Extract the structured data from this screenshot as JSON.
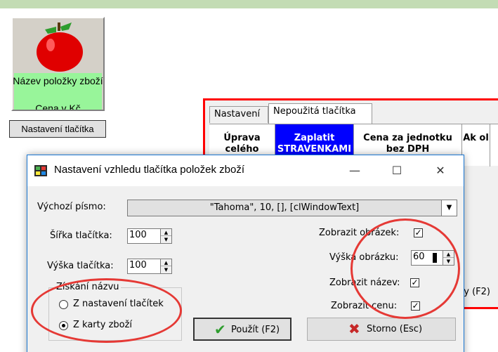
{
  "product_tile": {
    "name": "Název položky zboží",
    "price": "Cena v Kč",
    "image": "apple-icon"
  },
  "settings_button": {
    "label": "Nastavení tlačítka"
  },
  "background_window": {
    "tabs": [
      {
        "label": "Nastavení",
        "active": false
      },
      {
        "label": "Nepoužitá tlačítka",
        "active": true
      }
    ],
    "grid_cells": [
      {
        "label": "Úprava celého",
        "highlight": false
      },
      {
        "label": "Zaplatit STRAVENKAMI",
        "highlight": true
      },
      {
        "label": "Cena za jednotku bez DPH",
        "highlight": false
      },
      {
        "label": "Ak ol",
        "highlight": false
      }
    ],
    "partial_button": {
      "label": "ny (F2)"
    }
  },
  "dialog": {
    "title": "Nastavení vzhledu tlačítka položek zboží",
    "controls": {
      "minimize": "—",
      "maximize": "☐",
      "close": "✕"
    },
    "default_font": {
      "label": "Výchozí písmo:",
      "value": "\"Tahoma\", 10, [], [clWindowText]"
    },
    "width": {
      "label": "Šířka tlačítka:",
      "value": "100"
    },
    "height": {
      "label": "Výška tlačítka:",
      "value": "100"
    },
    "show_image": {
      "label": "Zobrazit obrázek:",
      "checked": true
    },
    "image_height": {
      "label": "Výška obrázku:",
      "value": "60"
    },
    "show_name": {
      "label": "Zobrazit název:",
      "checked": true
    },
    "show_price": {
      "label": "Zobrazit cenu:",
      "checked": true
    },
    "name_source": {
      "title": "Získání názvu",
      "options": [
        {
          "label": "Z nastavení tlačítek",
          "selected": false
        },
        {
          "label": "Z karty zboží",
          "selected": true
        }
      ]
    },
    "buttons": {
      "apply": "Použít (F2)",
      "cancel": "Storno (Esc)"
    }
  },
  "colors": {
    "accent_red": "#e53935",
    "tile_green": "#98f59a",
    "grid_blue": "#0000ff",
    "top_bar": "#c3dcb4"
  }
}
